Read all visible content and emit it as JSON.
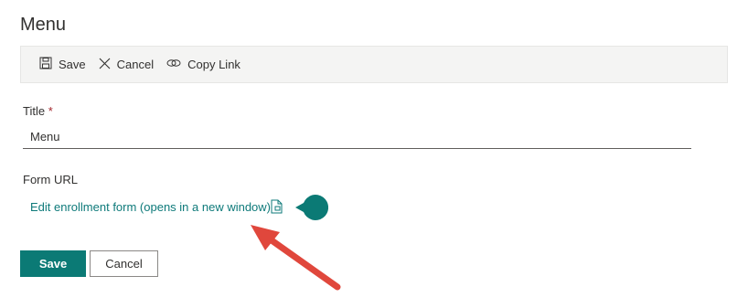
{
  "page": {
    "title": "Menu"
  },
  "toolbar": {
    "save_label": "Save",
    "cancel_label": "Cancel",
    "copy_link_label": "Copy Link"
  },
  "form": {
    "title_label": "Title",
    "required_marker": "*",
    "title_value": "Menu",
    "form_url_label": "Form URL",
    "link_text": "Edit enrollment form (opens in a new window)"
  },
  "buttons": {
    "save_label": "Save",
    "cancel_label": "Cancel"
  },
  "colors": {
    "accent": "#0b7a75",
    "link": "#0e7a7a",
    "annotation_arrow": "#e0473c"
  }
}
